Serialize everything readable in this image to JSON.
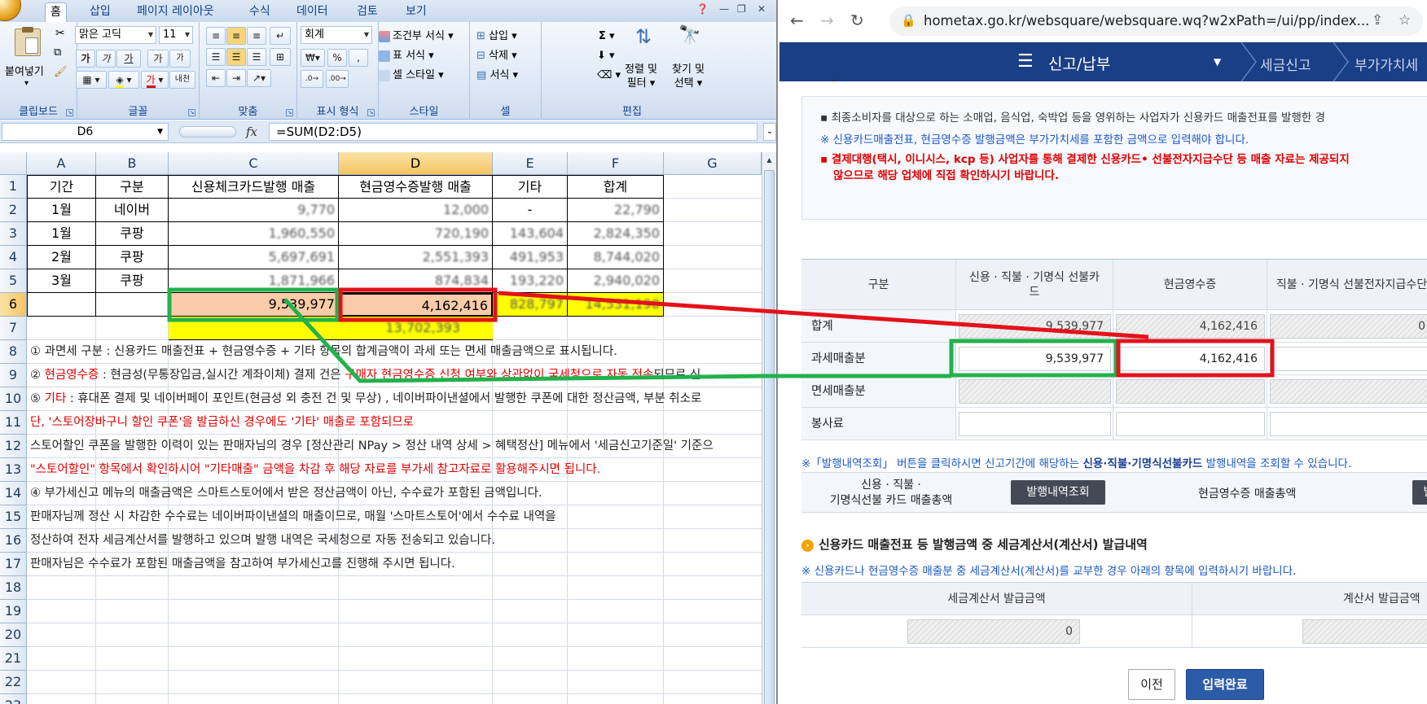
{
  "excel": {
    "tabs": [
      "홈",
      "삽입",
      "페이지 레이아웃",
      "수식",
      "데이터",
      "검토",
      "보기"
    ],
    "ribbon": {
      "clipboard": {
        "label": "클립보드",
        "paste": "붙여넣기"
      },
      "font": {
        "label": "글꼴",
        "font_name": "맑은 고딕",
        "font_size": "11",
        "bold": "가",
        "italic": "가",
        "underline": "가",
        "grow": "가",
        "shrink": "가",
        "color_glyph": "가",
        "phonetic": "내천"
      },
      "alignment": {
        "label": "맞춤"
      },
      "number": {
        "label": "표시 형식",
        "format": "회계",
        "currency": "₩",
        "percent": "%",
        "comma": ","
      },
      "styles": {
        "label": "스타일",
        "conditional": "조건부 서식",
        "table": "표 서식",
        "cell": "셀 스타일"
      },
      "cells": {
        "label": "셀",
        "insert": "삽입",
        "delete": "삭제",
        "format": "서식"
      },
      "editing": {
        "label": "편집",
        "sum": "Σ",
        "sort_filter_1": "정렬 및",
        "sort_filter_2": "필터",
        "find_1": "찾기 및",
        "find_2": "선택"
      }
    },
    "name_box": "D6",
    "fx_label": "fx",
    "formula": "=SUM(D2:D5)",
    "columns": [
      "A",
      "B",
      "C",
      "D",
      "E",
      "F",
      "G"
    ],
    "rows": [
      "1",
      "2",
      "3",
      "4",
      "5",
      "6",
      "7",
      "8",
      "9",
      "10",
      "11",
      "12",
      "13",
      "14",
      "15",
      "16",
      "17",
      "18",
      "19",
      "20",
      "21",
      "22",
      "23"
    ],
    "table_header": [
      "기간",
      "구분",
      "신용체크카드발행 매출",
      "현금영수증발행 매출",
      "기타",
      "합계"
    ],
    "table_rows": [
      [
        "1월",
        "네이버",
        "9,770",
        "12,000",
        "-",
        "22,790"
      ],
      [
        "1월",
        "쿠팡",
        "1,960,550",
        "720,190",
        "143,604",
        "2,824,350"
      ],
      [
        "2월",
        "쿠팡",
        "5,697,691",
        "2,551,393",
        "491,953",
        "8,744,020"
      ],
      [
        "3월",
        "쿠팡",
        "1,871,966",
        "874,834",
        "193,220",
        "2,940,020"
      ]
    ],
    "totals": {
      "c": "9,539,977",
      "d": "4,162,416",
      "e": "828,797",
      "f": "14,531,190"
    },
    "row7_total": "13,702,393",
    "notes": [
      {
        "parts": [
          {
            "t": "① 과면세 구분 : 신용카드 매출전표 + 현금영수증 + 기타 항목의 합계금액이 과세 또는 면세 매출금액으로 표시됩니다.",
            "red": false
          }
        ]
      },
      {
        "parts": [
          {
            "t": "② ",
            "red": false
          },
          {
            "t": "현금영수증",
            "red": true
          },
          {
            "t": " : 현금성(무통장입금,실시간 계좌이체) 결제 건은 ",
            "red": false
          },
          {
            "t": "구매자 현금영수증 신청 여부와 상관없이 국세청으로 자동 전송",
            "red": true
          },
          {
            "t": "되므로 신",
            "red": false
          }
        ]
      },
      {
        "parts": [
          {
            "t": "⑤ ",
            "red": false
          },
          {
            "t": "기타",
            "red": true
          },
          {
            "t": " : 휴대폰 결제 및 네이버페이 포인트(현금성 외 충전 건 및 무상) , 네이버파이낸셜에서 발행한 쿠폰에 대한 정산금액, 부분 취소로",
            "red": false
          }
        ]
      },
      {
        "parts": [
          {
            "t": "단, '스토어장바구니 할인 쿠폰'을 발급하신 경우에도 '기타' 매출로 포함되므로",
            "red": true
          }
        ]
      },
      {
        "parts": [
          {
            "t": "스토어할인 쿠폰을 발행한 이력이 있는 판매자님의 경우 [정산관리 NPay > 정산 내역 상세 > 혜택정산] 메뉴에서 '세금신고기준일' 기준으",
            "red": false
          }
        ]
      },
      {
        "parts": [
          {
            "t": "\"스토어할인\" 항목에서 확인하시어 \"기타매출\" 금액을 차감 후 해당 자료를 부가세 참고자료로 활용해주시면 됩니다.",
            "red": true
          }
        ]
      },
      {
        "parts": [
          {
            "t": "④ 부가세신고 메뉴의 매출금액은 스마트스토어에서 받은 정산금액이 아닌, 수수료가 포함된 금액입니다.",
            "red": false
          }
        ]
      },
      {
        "parts": [
          {
            "t": "판매자님께 정산 시 차감한 수수료는 네이버파이낸셜의 매출이므로, 매월 '스마트스토어'에서 수수료 내역을",
            "red": false
          }
        ]
      },
      {
        "parts": [
          {
            "t": "정산하여 전자 세금계산서를 발행하고 있으며 발행 내역은 국세청으로 자동 전송되고 있습니다.",
            "red": false
          }
        ]
      },
      {
        "parts": [
          {
            "t": "판매자님은 수수료가 포함된 매출금액을 참고하여 부가세신고를 진행해 주시면 됩니다.",
            "red": false
          }
        ]
      }
    ]
  },
  "browser": {
    "url": "hometax.go.kr/websquare/websquare.wq?w2xPath=/ui/pp/index...",
    "nav_title": "신고/납부",
    "crumbs": [
      "세금신고",
      "부가가치세"
    ],
    "info_lines": [
      {
        "text": "최종소비자를 대상으로 하는 소매업, 음식업, 숙박업 등을 영위하는 사업자가 신용카드 매출전표를 발행한 경",
        "style": "gray",
        "prefix": "▪ "
      },
      {
        "text": "※ 신용카드매출전표, 현금영수증 발행금액은 부가가치세를 포함한 금액으로 입력해야 합니다.",
        "style": "blue",
        "prefix": ""
      },
      {
        "text": "결제대행(택시, 이니시스, kcp 등) 사업자를 통해 결제한 신용카드• 선불전자지급수단 등 매출 자료는 제공되지",
        "style": "red",
        "prefix": "▪ "
      },
      {
        "text": "않으므로 해당 업체에 직접 확인하시기 바랍니다.",
        "style": "red",
        "prefix": ""
      }
    ],
    "table": {
      "headers": [
        "구분",
        "신용 · 직불 · 기명식 선불카드",
        "현금영수증",
        "직불 · 기명식 선불전자지급수단"
      ],
      "rows": [
        {
          "label": "합계",
          "values": [
            "9,539,977",
            "4,162,416",
            "0"
          ]
        },
        {
          "label": "과세매출분",
          "values": [
            "9,539,977",
            "4,162,416",
            ""
          ]
        },
        {
          "label": "면세매출분",
          "values": [
            "",
            "",
            ""
          ]
        },
        {
          "label": "봉사료",
          "values": [
            "",
            "",
            ""
          ]
        }
      ]
    },
    "lookup_note_pre": "※「발행내역조회」 버튼을 클릭하시면 신고기간에 해당하는 ",
    "lookup_note_bold": "신용·직불·기명식선불카드",
    "lookup_note_post": " 발행내역을 조회할 수 있습니다.",
    "issue_label_1": "신용 · 직불 ·",
    "issue_label_2": "기명식선불 카드 매출총액",
    "issue_button": "발행내역조회",
    "cash_total_label": "현금영수증 매출총액",
    "cash_button": "발",
    "section_title": "신용카드 매출전표 등 발행금액 중 세금계산서(계산서) 발급내역",
    "section_note": "※ 신용카드나 현금영수증 매출분 중 세금계산서(계산서)를 교부한 경우 아래의 항목에 입력하시기 바랍니다.",
    "tax_headers": [
      "세금계산서 발급금액",
      "계산서 발급금액"
    ],
    "tax_value": "0",
    "btn_prev": "이전",
    "btn_complete": "입력완료"
  },
  "colors": {
    "green_box": "#22b14c",
    "red_box": "#e3121b",
    "navy": "#1b3f86",
    "cell_peach": "#f9cba8",
    "cell_yellow": "#ffff00"
  }
}
